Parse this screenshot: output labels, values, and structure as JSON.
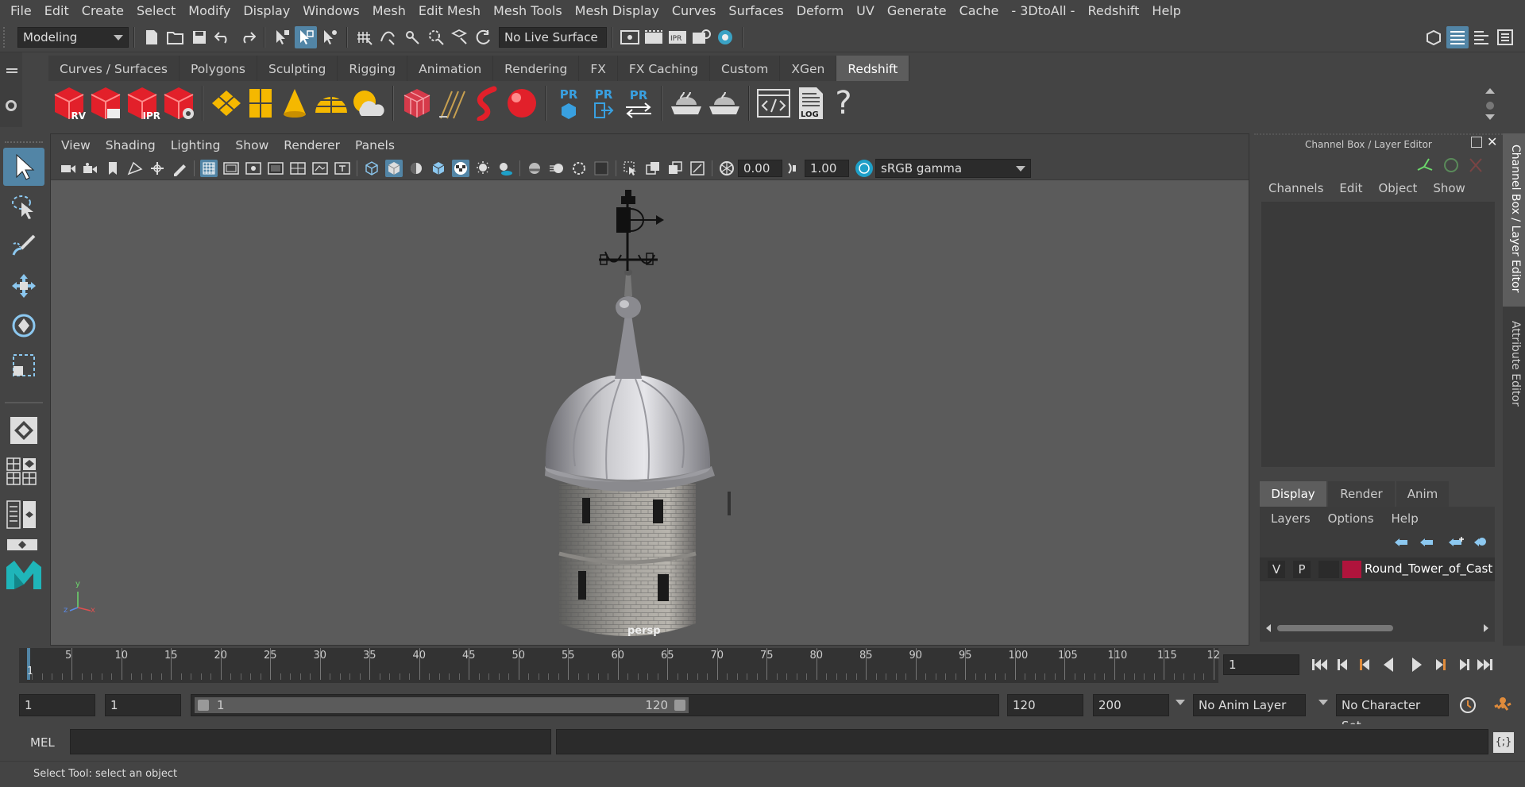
{
  "menubar": {
    "items": [
      "File",
      "Edit",
      "Create",
      "Select",
      "Modify",
      "Display",
      "Windows",
      "Mesh",
      "Edit Mesh",
      "Mesh Tools",
      "Mesh Display",
      "Curves",
      "Surfaces",
      "Deform",
      "UV",
      "Generate",
      "Cache",
      "- 3DtoAll -",
      "Redshift",
      "Help"
    ]
  },
  "status_line": {
    "mode": "Modeling",
    "live_surface": "No Live Surface"
  },
  "shelf": {
    "tabs": [
      "Curves / Surfaces",
      "Polygons",
      "Sculpting",
      "Rigging",
      "Animation",
      "Rendering",
      "FX",
      "FX Caching",
      "Custom",
      "XGen",
      "Redshift"
    ],
    "active_tab": "Redshift",
    "icon_labels": {
      "rv": "RV",
      "ipr": "IPR",
      "pr1": "PR",
      "pr2": "PR",
      "pr3": "PR",
      "log": "LOG"
    }
  },
  "viewport": {
    "menu": [
      "View",
      "Shading",
      "Lighting",
      "Show",
      "Renderer",
      "Panels"
    ],
    "exposure": "0.00",
    "gamma": "1.00",
    "color_space": "sRGB gamma",
    "camera_label": "persp",
    "axis": {
      "x": "x",
      "y": "y",
      "z": "z"
    }
  },
  "channel_box": {
    "title": "Channel Box / Layer Editor",
    "menu": [
      "Channels",
      "Edit",
      "Object",
      "Show"
    ],
    "side_tabs": [
      "Channel Box / Layer Editor",
      "Attribute Editor"
    ]
  },
  "layer_editor": {
    "tabs": [
      "Display",
      "Render",
      "Anim"
    ],
    "active_tab": "Display",
    "menu": [
      "Layers",
      "Options",
      "Help"
    ],
    "layer": {
      "v": "V",
      "p": "P",
      "name": "Round_Tower_of_Cast",
      "color": "#b0143c"
    }
  },
  "timeline": {
    "ticks": [
      "5",
      "10",
      "15",
      "20",
      "25",
      "30",
      "35",
      "40",
      "45",
      "50",
      "55",
      "60",
      "65",
      "70",
      "75",
      "80",
      "85",
      "90",
      "95",
      "100",
      "105",
      "110",
      "115",
      "12"
    ],
    "first_frame": "1",
    "current_frame": "1"
  },
  "range": {
    "start": "1",
    "playback_start": "1",
    "slider_start": "1",
    "slider_end": "120",
    "playback_end": "120",
    "end": "200",
    "anim_layer": "No Anim Layer",
    "character_set": "No Character Set"
  },
  "command_line": {
    "label": "MEL"
  },
  "help_line": {
    "text": "Select Tool: select an object"
  },
  "colors": {
    "accent": "#5285a6",
    "redshift": "#e2202a",
    "yellow": "#f5b800",
    "pr_blue": "#39a0e0"
  }
}
